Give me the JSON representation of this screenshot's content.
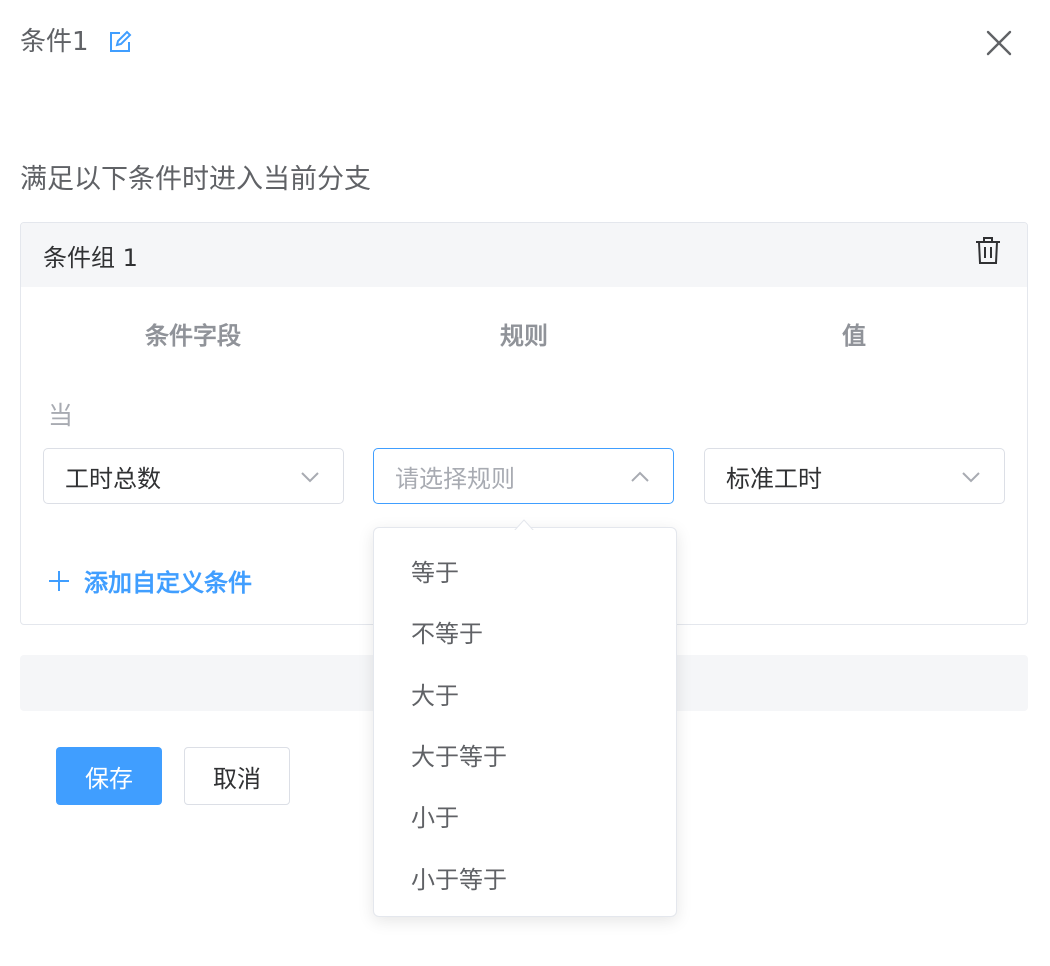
{
  "header": {
    "title": "条件1"
  },
  "subtitle": "满足以下条件时进入当前分支",
  "group": {
    "title": "条件组 1",
    "columns": {
      "field": "条件字段",
      "rule": "规则",
      "value": "值"
    },
    "when_label": "当",
    "field_select": {
      "value": "工时总数"
    },
    "rule_select": {
      "placeholder": "请选择规则"
    },
    "value_select": {
      "value": "标准工时"
    },
    "add_condition": "添加自定义条件"
  },
  "dropdown": {
    "options": [
      "等于",
      "不等于",
      "大于",
      "大于等于",
      "小于",
      "小于等于"
    ]
  },
  "footer": {
    "save_label": "保存",
    "cancel_label": "取消"
  },
  "colors": {
    "primary": "#409eff",
    "border": "#dcdfe6",
    "panel_bg": "#f5f6f8"
  },
  "icons": [
    "edit-icon",
    "close-icon",
    "trash-icon",
    "chevron-down-icon",
    "chevron-up-icon",
    "plus-icon"
  ]
}
